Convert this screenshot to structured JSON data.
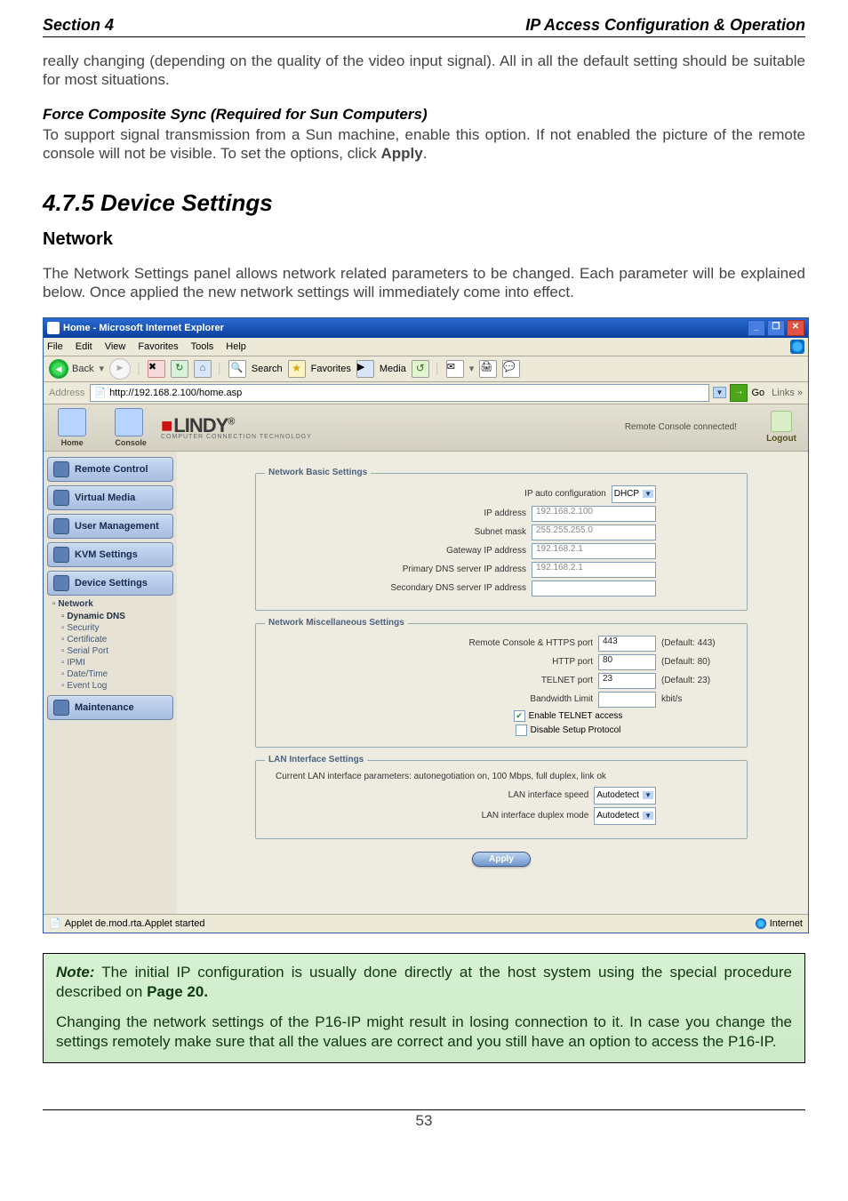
{
  "header": {
    "left": "Section 4",
    "right": "IP Access Configuration & Operation"
  },
  "body": {
    "p1": "really changing (depending on the quality of the video input signal). All in all the default setting should be suitable for most situations.",
    "sub1": "Force Composite Sync (Required for Sun Computers)",
    "p2a": "To support signal transmission from a Sun machine, enable this option. If not enabled the picture of the remote console will not be visible. To set the options, click ",
    "p2b": "Apply",
    "p2c": ".",
    "sectionTitle": "4.7.5  Device Settings",
    "networkHead": "Network",
    "p3": "The Network Settings panel allows network related parameters to be changed.  Each parameter will be explained below. Once applied the new network settings will immediately come into effect."
  },
  "ie": {
    "title": "Home - Microsoft Internet Explorer",
    "menus": [
      "File",
      "Edit",
      "View",
      "Favorites",
      "Tools",
      "Help"
    ],
    "toolbar": {
      "back": "Back",
      "search": "Search",
      "favorites": "Favorites",
      "media": "Media"
    },
    "address": {
      "label": "Address",
      "url": "http://192.168.2.100/home.asp",
      "go": "Go",
      "links": "Links »"
    },
    "statusbar": {
      "left": "Applet de.mod.rta.Applet started",
      "right": "Internet"
    }
  },
  "banner": {
    "home": "Home",
    "console": "Console",
    "logoTop": "LINDY",
    "logoSub": "COMPUTER CONNECTION TECHNOLOGY",
    "status": "Remote Console connected!",
    "logout": "Logout"
  },
  "nav": {
    "buttons": [
      "Remote Control",
      "Virtual Media",
      "User Management",
      "KVM Settings",
      "Device Settings"
    ],
    "tree": {
      "root": "Network",
      "items": [
        "Dynamic DNS",
        "Security",
        "Certificate",
        "Serial Port",
        "IPMI",
        "Date/Time",
        "Event Log"
      ]
    },
    "maintenance": "Maintenance"
  },
  "forms": {
    "basic": {
      "legend": "Network Basic Settings",
      "rows": {
        "ipauto": {
          "label": "IP auto configuration",
          "value": "DHCP"
        },
        "ipaddr": {
          "label": "IP address",
          "value": "192.168.2.100"
        },
        "subnet": {
          "label": "Subnet mask",
          "value": "255.255.255.0"
        },
        "gateway": {
          "label": "Gateway IP address",
          "value": "192.168.2.1"
        },
        "dns1": {
          "label": "Primary DNS server IP address",
          "value": "192.168.2.1"
        },
        "dns2": {
          "label": "Secondary DNS server IP address",
          "value": ""
        }
      }
    },
    "misc": {
      "legend": "Network Miscellaneous Settings",
      "rows": {
        "rchttps": {
          "label": "Remote Console & HTTPS port",
          "value": "443",
          "hint": "(Default: 443)"
        },
        "http": {
          "label": "HTTP port",
          "value": "80",
          "hint": "(Default: 80)"
        },
        "telnet": {
          "label": "TELNET port",
          "value": "23",
          "hint": "(Default: 23)"
        },
        "bw": {
          "label": "Bandwidth Limit",
          "value": "",
          "hint": "kbit/s"
        }
      },
      "chk1": "Enable TELNET access",
      "chk2": "Disable Setup Protocol"
    },
    "lan": {
      "legend": "LAN Interface Settings",
      "note": "Current LAN interface parameters: autonegotiation on, 100 Mbps, full duplex, link ok",
      "rows": {
        "speed": {
          "label": "LAN interface speed",
          "value": "Autodetect"
        },
        "duplex": {
          "label": "LAN interface duplex mode",
          "value": "Autodetect"
        }
      }
    },
    "apply": "Apply"
  },
  "note": {
    "boldLabel": "Note:",
    "line1a": " The initial IP configuration is usually done directly at the host system using the special procedure described on ",
    "line1b": "Page 20.",
    "line2": "Changing the network settings of the P16-IP might result in losing connection to it. In case you change the settings remotely make sure that all the values are correct and you still have an option to access the P16-IP."
  },
  "footer": {
    "page": "53"
  }
}
